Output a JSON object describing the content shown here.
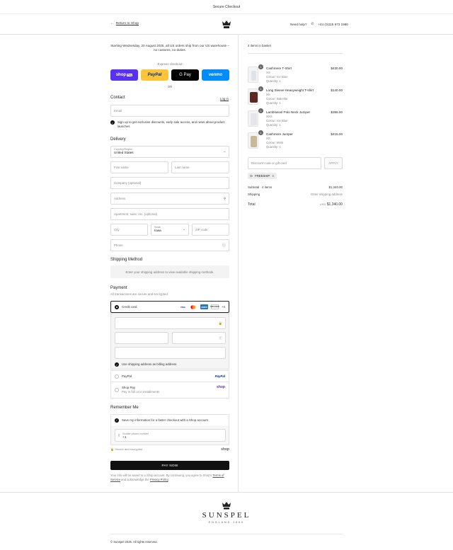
{
  "topbar": {
    "title": "Secure Checkout"
  },
  "header": {
    "back_label": "Return to Shop",
    "help_label": "Need help?",
    "phone": "+44 (0)115 973 1980"
  },
  "notice": "Starting Wednesday, 20 August 2025, all US orders ship from our US warehouse – no customs, no duties.",
  "express": {
    "label": "Express checkout",
    "shop": "shop",
    "shop_badge": "Pay",
    "paypal": "PayPal",
    "gpay": "G Pay",
    "venmo": "venmo",
    "or": "OR"
  },
  "contact": {
    "title": "Contact",
    "login": "Log in",
    "email_placeholder": "Email",
    "signup": "Sign up to get exclusive discounts, early sale access, and news about product launches"
  },
  "delivery": {
    "title": "Delivery",
    "country_label": "Country/Region",
    "country_value": "United States",
    "first_name": "First name",
    "last_name": "Last name",
    "company": "Company (optional)",
    "address": "Address",
    "apartment": "Apartment, suite, etc. (optional)",
    "city": "City",
    "state_label": "State",
    "state_value": "Iowa",
    "zip": "ZIP code",
    "phone": "Phone"
  },
  "shipping": {
    "title": "Shipping Method",
    "message": "Enter your shipping address to view available shipping methods."
  },
  "payment": {
    "title": "Payment",
    "subtitle": "All transactions are secure and encrypted.",
    "credit_card": "Credit card",
    "cards": [
      "VISA",
      "MC",
      "AMEX",
      "DISCOVER"
    ],
    "more_cards": "+4",
    "billing": "Use shipping address as billing address",
    "paypal": "PayPal",
    "paypal_logo": "PayPal",
    "shoppay": "Shop Pay",
    "shoppay_sub": "Pay in full or in installments",
    "shoppay_logo": "shop"
  },
  "remember": {
    "title": "Remember Me",
    "save": "Save my information for a faster checkout with a Shop account",
    "mobile_label": "Mobile phone number",
    "mobile_value": "+1",
    "secure": "Secure and encrypted",
    "shop_logo": "shop"
  },
  "paynow": "PAY NOW",
  "legal": {
    "pre": "Your info will be saved to a Shop account. By continuing, you agree to Shop's",
    "terms": "Terms of Service",
    "mid": "and acknowledge the",
    "privacy": "Privacy Policy",
    "post": "."
  },
  "basket": {
    "title": "4 items in basket",
    "items": [
      {
        "name": "Cashmere T-Shirt",
        "size": "XS",
        "colour": "Colour: Ice Blue",
        "quantity": "Quantity: 1",
        "price": "$430.00",
        "qty": "1",
        "swatch": "#dfe3ea"
      },
      {
        "name": "Long Sleeve Heavyweight T-shirt",
        "size": "XS",
        "colour": "Colour: Bakelite",
        "quantity": "Quantity: 1",
        "price": "$140.00",
        "qty": "1",
        "swatch": "#5a2a22"
      },
      {
        "name": "Lambswool Polo Neck Jumper",
        "size": "XXS",
        "colour": "Colour: Ice Blue",
        "quantity": "Quantity: 1",
        "price": "$355.00",
        "qty": "1",
        "swatch": "#e6e6ea"
      },
      {
        "name": "Cashmere Jumper",
        "size": "XS",
        "colour": "Colour: Mink",
        "quantity": "Quantity: 1",
        "price": "$415.00",
        "qty": "1",
        "swatch": "#c9b79a"
      }
    ]
  },
  "discount": {
    "placeholder": "Discount code or gift card",
    "apply": "APPLY",
    "tag": "FREESHIP"
  },
  "summary": {
    "subtotal_label": "Subtotal · 4 items",
    "subtotal_value": "$1,340.00",
    "shipping_label": "Shipping",
    "shipping_value": "Enter shipping address",
    "total_label": "Total",
    "currency": "USD",
    "total_value": "$1,340.00"
  },
  "footer": {
    "brand": "SUNSPEL",
    "tagline": "ENGLAND 1860",
    "copyright": "© Sunspel 2025. All rights reserved."
  }
}
